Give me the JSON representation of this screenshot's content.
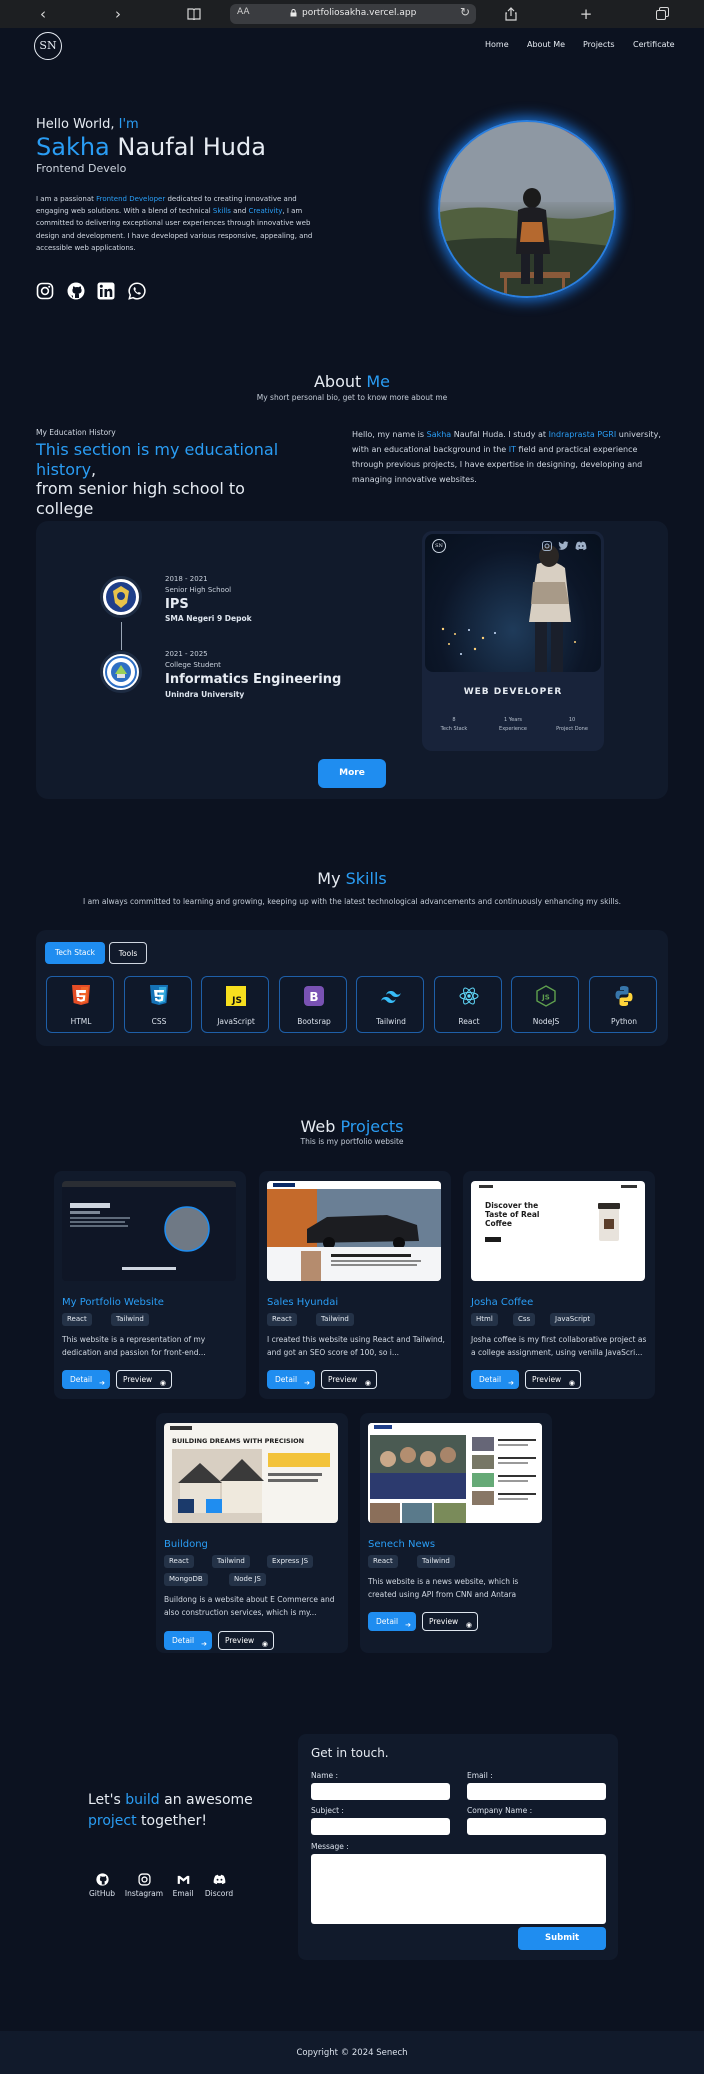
{
  "browser": {
    "text_size_label": "AA",
    "url": "portfoliosakha.vercel.app"
  },
  "nav": {
    "logo": "SN",
    "links": [
      "Home",
      "About Me",
      "Projects",
      "Certificate"
    ]
  },
  "hero": {
    "greeting_plain": "Hello World, ",
    "greeting_accent": "I'm",
    "name_first": "Sakha",
    "name_rest": " Naufal Huda",
    "role": "Frontend Develo",
    "desc_1": "I am a passionat ",
    "desc_accent_1": "Frontend Developer",
    "desc_2": " dedicated to creating innovative and engaging web solutions. With a blend of technical ",
    "desc_accent_2": "Skills",
    "desc_3": " and ",
    "desc_accent_3": "Creativity",
    "desc_4": ", I am committed to delivering exceptional user experiences through innovative web design and development. I have developed various responsive, appealing, and accessible web applications."
  },
  "about": {
    "title_plain": "About ",
    "title_accent": "Me",
    "subtitle": "My short personal bio, get to know more about me",
    "edu_label": "My Education History",
    "edu_title_accent": "This section is my educational history",
    "edu_title_comma": ",",
    "edu_title_rest": "from senior high school to college",
    "bio_1": "Hello, my name is ",
    "bio_accent_1": "Sakha",
    "bio_2": " Naufal Huda. I study at ",
    "bio_accent_2": "Indraprasta PGRI",
    "bio_3": " university, with an educational background in the ",
    "bio_accent_3": "IT",
    "bio_4": " field and practical experience through previous projects, I have expertise in designing, developing and managing innovative websites.",
    "timeline": [
      {
        "years": "2018 - 2021",
        "level": "Senior High School",
        "major": "IPS",
        "school": "SMA Negeri 9 Depok"
      },
      {
        "years": "2021 - 2025",
        "level": "College Student",
        "major": "Informatics Engineering",
        "school": "Unindra University"
      }
    ],
    "card": {
      "logo": "SN",
      "title": "WEB DEVELOPER",
      "stats": [
        {
          "value": "8",
          "label": "Tech Stack"
        },
        {
          "value": "1 Years",
          "label": "Experience"
        },
        {
          "value": "10",
          "label": "Project Done"
        }
      ]
    },
    "more_label": "More"
  },
  "skills": {
    "title_plain": "My ",
    "title_accent": "Skills",
    "subtitle": "I am always committed to learning and growing, keeping up with the latest technological advancements and continuously enhancing my skills.",
    "tabs": [
      "Tech Stack",
      "Tools"
    ],
    "active_tab": "Tech Stack",
    "items": [
      {
        "name": "HTML",
        "icon": "html5-icon"
      },
      {
        "name": "CSS",
        "icon": "css3-icon"
      },
      {
        "name": "JavaScript",
        "icon": "javascript-icon"
      },
      {
        "name": "Bootsrap",
        "icon": "bootstrap-icon"
      },
      {
        "name": "Tailwind",
        "icon": "tailwind-icon"
      },
      {
        "name": "React",
        "icon": "react-icon"
      },
      {
        "name": "NodeJS",
        "icon": "nodejs-icon"
      },
      {
        "name": "Python",
        "icon": "python-icon"
      }
    ]
  },
  "projects": {
    "title_plain": "Web ",
    "title_accent": "Projects",
    "subtitle": "This is my portfolio website",
    "detail_label": "Detail",
    "preview_label": "Preview",
    "items": [
      {
        "title": "My Portfolio Website",
        "tags": [
          "React",
          "Tailwind"
        ],
        "desc": "This website is a representation of my dedication and passion for front-end..."
      },
      {
        "title": "Sales Hyundai",
        "tags": [
          "React",
          "Tailwind"
        ],
        "desc": "I created this website using React and Tailwind, and got an SEO score of 100, so i..."
      },
      {
        "title": "Josha Coffee",
        "tags": [
          "Html",
          "Css",
          "JavaScript"
        ],
        "desc": "Josha coffee is my first collaborative project as a college assignment, using venilla JavaScri...",
        "shot_heading": "Discover the Taste of Real Coffee"
      },
      {
        "title": "Buildong",
        "tags": [
          "React",
          "Tailwind",
          "Express JS",
          "MongoDB",
          "Node JS"
        ],
        "desc": "Buildong is a website about E Commerce and also construction services, which is my...",
        "shot_heading": "BUILDING DREAMS WITH PRECISION"
      },
      {
        "title": "Senech News",
        "tags": [
          "React",
          "Tailwind"
        ],
        "desc": "This website is a news website, which is created using API from CNN and Antara"
      }
    ]
  },
  "contact": {
    "cta_1": "Let's ",
    "cta_accent_1": "build",
    "cta_2": " an awesome ",
    "cta_accent_2": "project",
    "cta_3": " together!",
    "links": [
      "GitHub",
      "Instagram",
      "Email",
      "Discord"
    ],
    "form_title": "Get in touch.",
    "fields": {
      "name": "Name :",
      "email": "Email :",
      "subject": "Subject :",
      "company": "Company Name :",
      "message": "Message :"
    },
    "submit_label": "Submit"
  },
  "footer": {
    "text": "Copyright © 2024 Senech"
  },
  "colors": {
    "background": "#0c1220",
    "panel": "#111a2b",
    "accent": "#2a9df4",
    "button": "#1f8df0"
  }
}
